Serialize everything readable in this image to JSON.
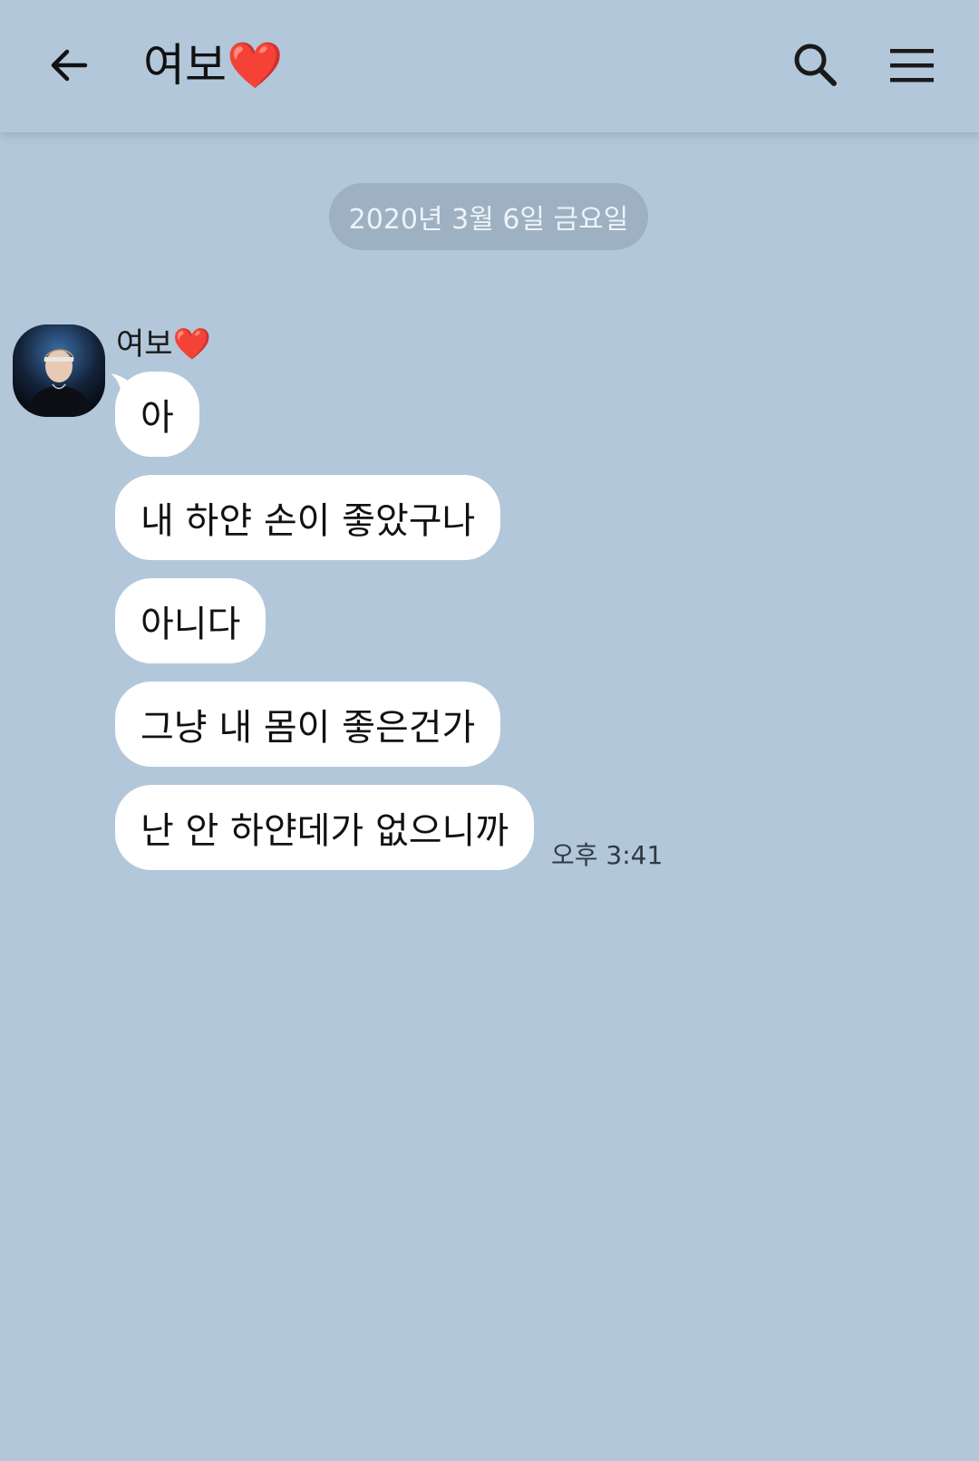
{
  "header": {
    "title": "여보❤️"
  },
  "chat": {
    "date": "2020년 3월 6일 금요일",
    "sender": "여보❤️",
    "messages": [
      "아",
      "내 하얀 손이 좋았구나",
      "아니다",
      "그냥 내 몸이 좋은건가",
      "난 안 하얀데가 없으니까"
    ],
    "time": "오후 3:41"
  }
}
